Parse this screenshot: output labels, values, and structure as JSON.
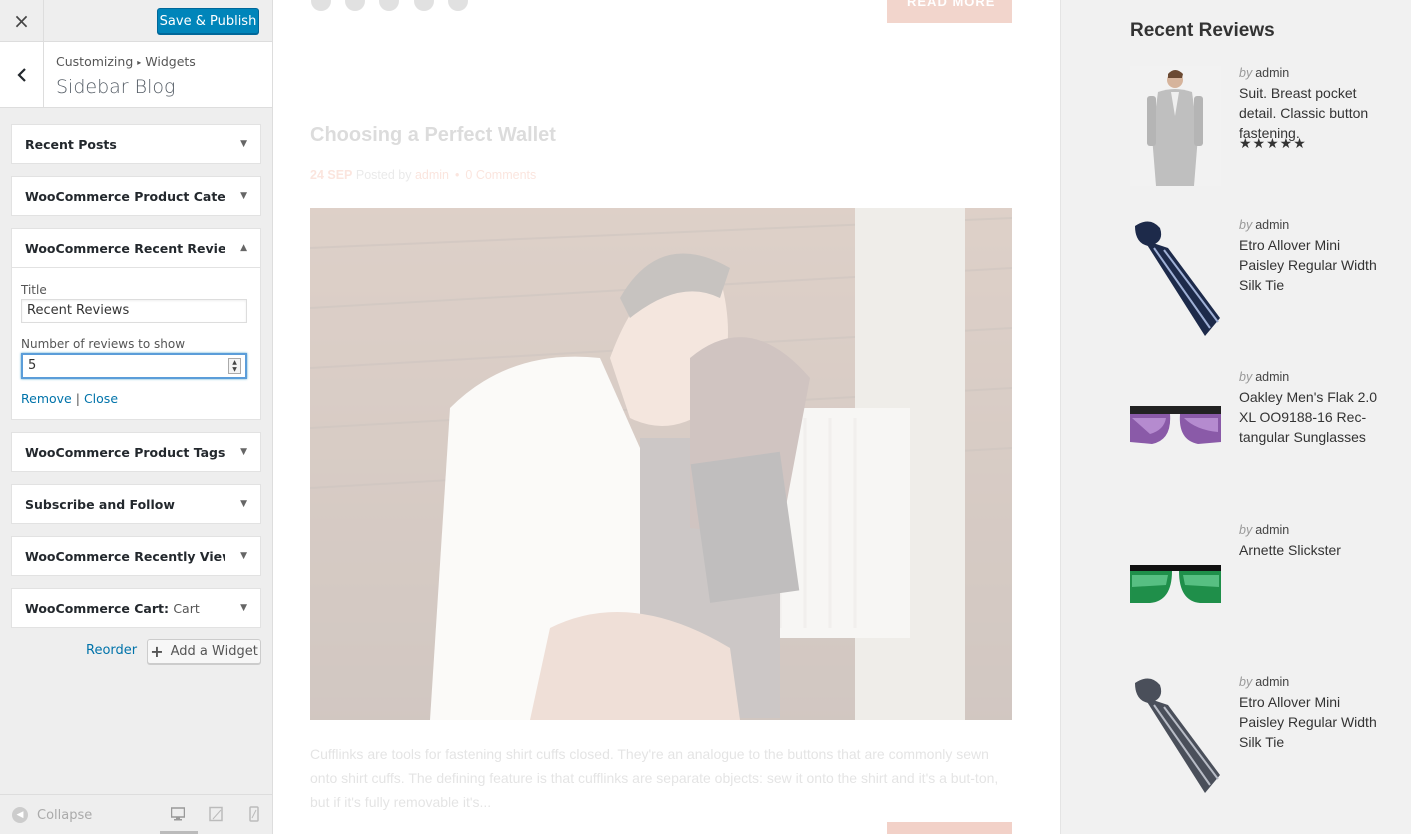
{
  "customizer": {
    "close_icon": "×",
    "publish_label": "Save & Publish",
    "back_icon": "‹",
    "breadcrumb_root": "Customizing",
    "breadcrumb_sep": "▸",
    "breadcrumb_parent": "Widgets",
    "section_title": "Sidebar Blog",
    "widgets": [
      {
        "name": "Recent Posts",
        "expanded": false
      },
      {
        "name": "WooCommerce Product Catego...",
        "expanded": false
      },
      {
        "name": "WooCommerce Recent Reviews...",
        "expanded": true
      },
      {
        "name": "WooCommerce Product Tags: T...",
        "expanded": false
      },
      {
        "name": "Subscribe and Follow",
        "expanded": false
      },
      {
        "name": "WooCommerce Recently Viewed",
        "expanded": false
      },
      {
        "name": "WooCommerce Cart:",
        "sub": "Cart",
        "expanded": false
      }
    ],
    "arrow_down": "▼",
    "arrow_up": "▲",
    "form": {
      "title_label": "Title",
      "title_value": "Recent Reviews",
      "count_label": "Number of reviews to show",
      "count_value": "5",
      "remove_label": "Remove",
      "pipe": "|",
      "close_label": "Close"
    },
    "reorder_label": "Reorder",
    "add_widget_label": "Add a Widget",
    "add_widget_icon": "+",
    "collapse_label": "Collapse",
    "collapse_icon": "◀",
    "active_device": "desktop"
  },
  "preview": {
    "post_title": "Choosing a Perfect Wallet",
    "meta_date": "24 SEP",
    "meta_posted_by": "Posted by",
    "meta_author": "admin",
    "meta_dot": "•",
    "meta_comments": "0 Comments",
    "read_more": "READ MORE",
    "excerpt": "Cufflinks are tools for fastening shirt cuffs closed. They're an analogue to the buttons that are commonly sewn onto shirt cuffs. The defining feature is that cufflinks are separate objects: sew it onto the shirt and it's a but-ton, but if it's fully removable it's..."
  },
  "recent_reviews": {
    "heading": "Recent Reviews",
    "by_label": "by",
    "items": [
      {
        "author": "admin",
        "product": "Suit. Breast pocket detail. Classic button fastening.",
        "stars": "★★★★★",
        "thumb": "suit"
      },
      {
        "author": "admin",
        "product": "Etro Allover Mini Paisley Regular Width Silk Tie",
        "stars": "",
        "thumb": "tie-navy"
      },
      {
        "author": "admin",
        "product": "Oakley Men's Flak 2.0 XL OO9188-16 Rec-tangular Sunglasses",
        "stars": "",
        "thumb": "sunglasses-purple"
      },
      {
        "author": "admin",
        "product": "Arnette Slickster",
        "stars": "",
        "thumb": "sunglasses-green"
      },
      {
        "author": "admin",
        "product": "Etro Allover Mini Paisley Regular Width Silk Tie",
        "stars": "",
        "thumb": "tie-grey"
      }
    ]
  },
  "colors": {
    "accent": "#0085ba",
    "link": "#0073aa",
    "post_meta_accent": "#e2582d"
  }
}
